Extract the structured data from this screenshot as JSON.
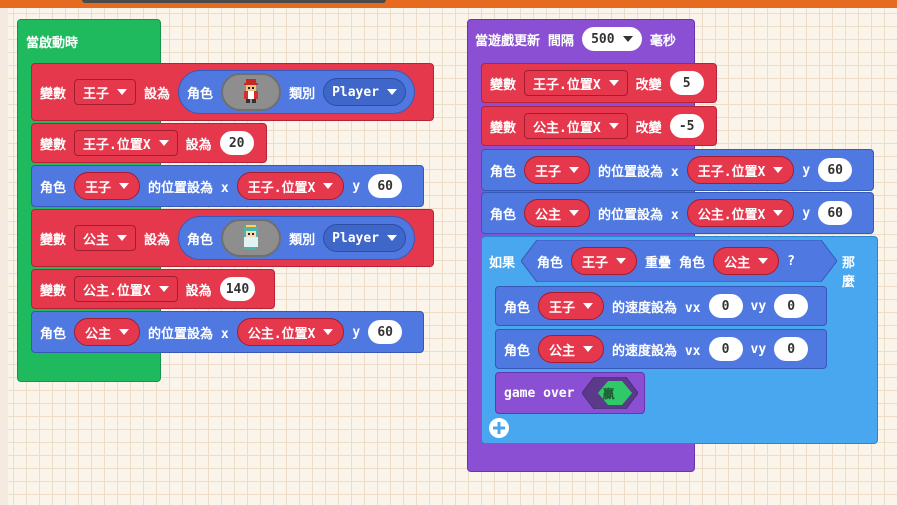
{
  "colors": {
    "event": "#1fba5e",
    "variable": "#e5384d",
    "sprite": "#4f78e0",
    "game": "#8a4fd2",
    "logic": "#48a7ee"
  },
  "on_start": {
    "label": "當啟動時",
    "rows": [
      {
        "kw": "變數",
        "var": "王子",
        "set": "設為",
        "sprite_kw": "角色",
        "kind": "類別",
        "kind_val": "Player"
      },
      {
        "kw": "變數",
        "var": "王子.位置X",
        "set": "設為",
        "value": "20"
      },
      {
        "kw": "角色",
        "var": "王子",
        "pos": "的位置設為 x",
        "xvar": "王子.位置X",
        "y": "y",
        "yval": "60"
      },
      {
        "kw": "變數",
        "var": "公主",
        "set": "設為",
        "sprite_kw": "角色",
        "kind": "類別",
        "kind_val": "Player"
      },
      {
        "kw": "變數",
        "var": "公主.位置X",
        "set": "設為",
        "value": "140"
      },
      {
        "kw": "角色",
        "var": "公主",
        "pos": "的位置設為 x",
        "xvar": "公主.位置X",
        "y": "y",
        "yval": "60"
      }
    ]
  },
  "on_update": {
    "label": "當遊戲更新 間隔",
    "interval": "500",
    "unit": "毫秒",
    "rows": [
      {
        "kw": "變數",
        "var": "王子.位置X",
        "change": "改變",
        "value": "5"
      },
      {
        "kw": "變數",
        "var": "公主.位置X",
        "change": "改變",
        "value": "-5"
      },
      {
        "kw": "角色",
        "var": "王子",
        "pos": "的位置設為 x",
        "xvar": "王子.位置X",
        "y": "y",
        "yval": "60"
      },
      {
        "kw": "角色",
        "var": "公主",
        "pos": "的位置設為 x",
        "xvar": "公主.位置X",
        "y": "y",
        "yval": "60"
      }
    ],
    "if_block": {
      "if": "如果",
      "sprite1_kw": "角色",
      "sprite1": "王子",
      "overlap": "重疊",
      "sprite2_kw": "角色",
      "sprite2": "公主",
      "q": "?",
      "then": "那麼",
      "inner": [
        {
          "kw": "角色",
          "var": "王子",
          "vel": "的速度設為 vx",
          "vx": "0",
          "vy_lbl": "vy",
          "vy": "0"
        },
        {
          "kw": "角色",
          "var": "公主",
          "vel": "的速度設為 vx",
          "vx": "0",
          "vy_lbl": "vy",
          "vy": "0"
        }
      ],
      "gameover": "game over",
      "win": "贏"
    }
  }
}
